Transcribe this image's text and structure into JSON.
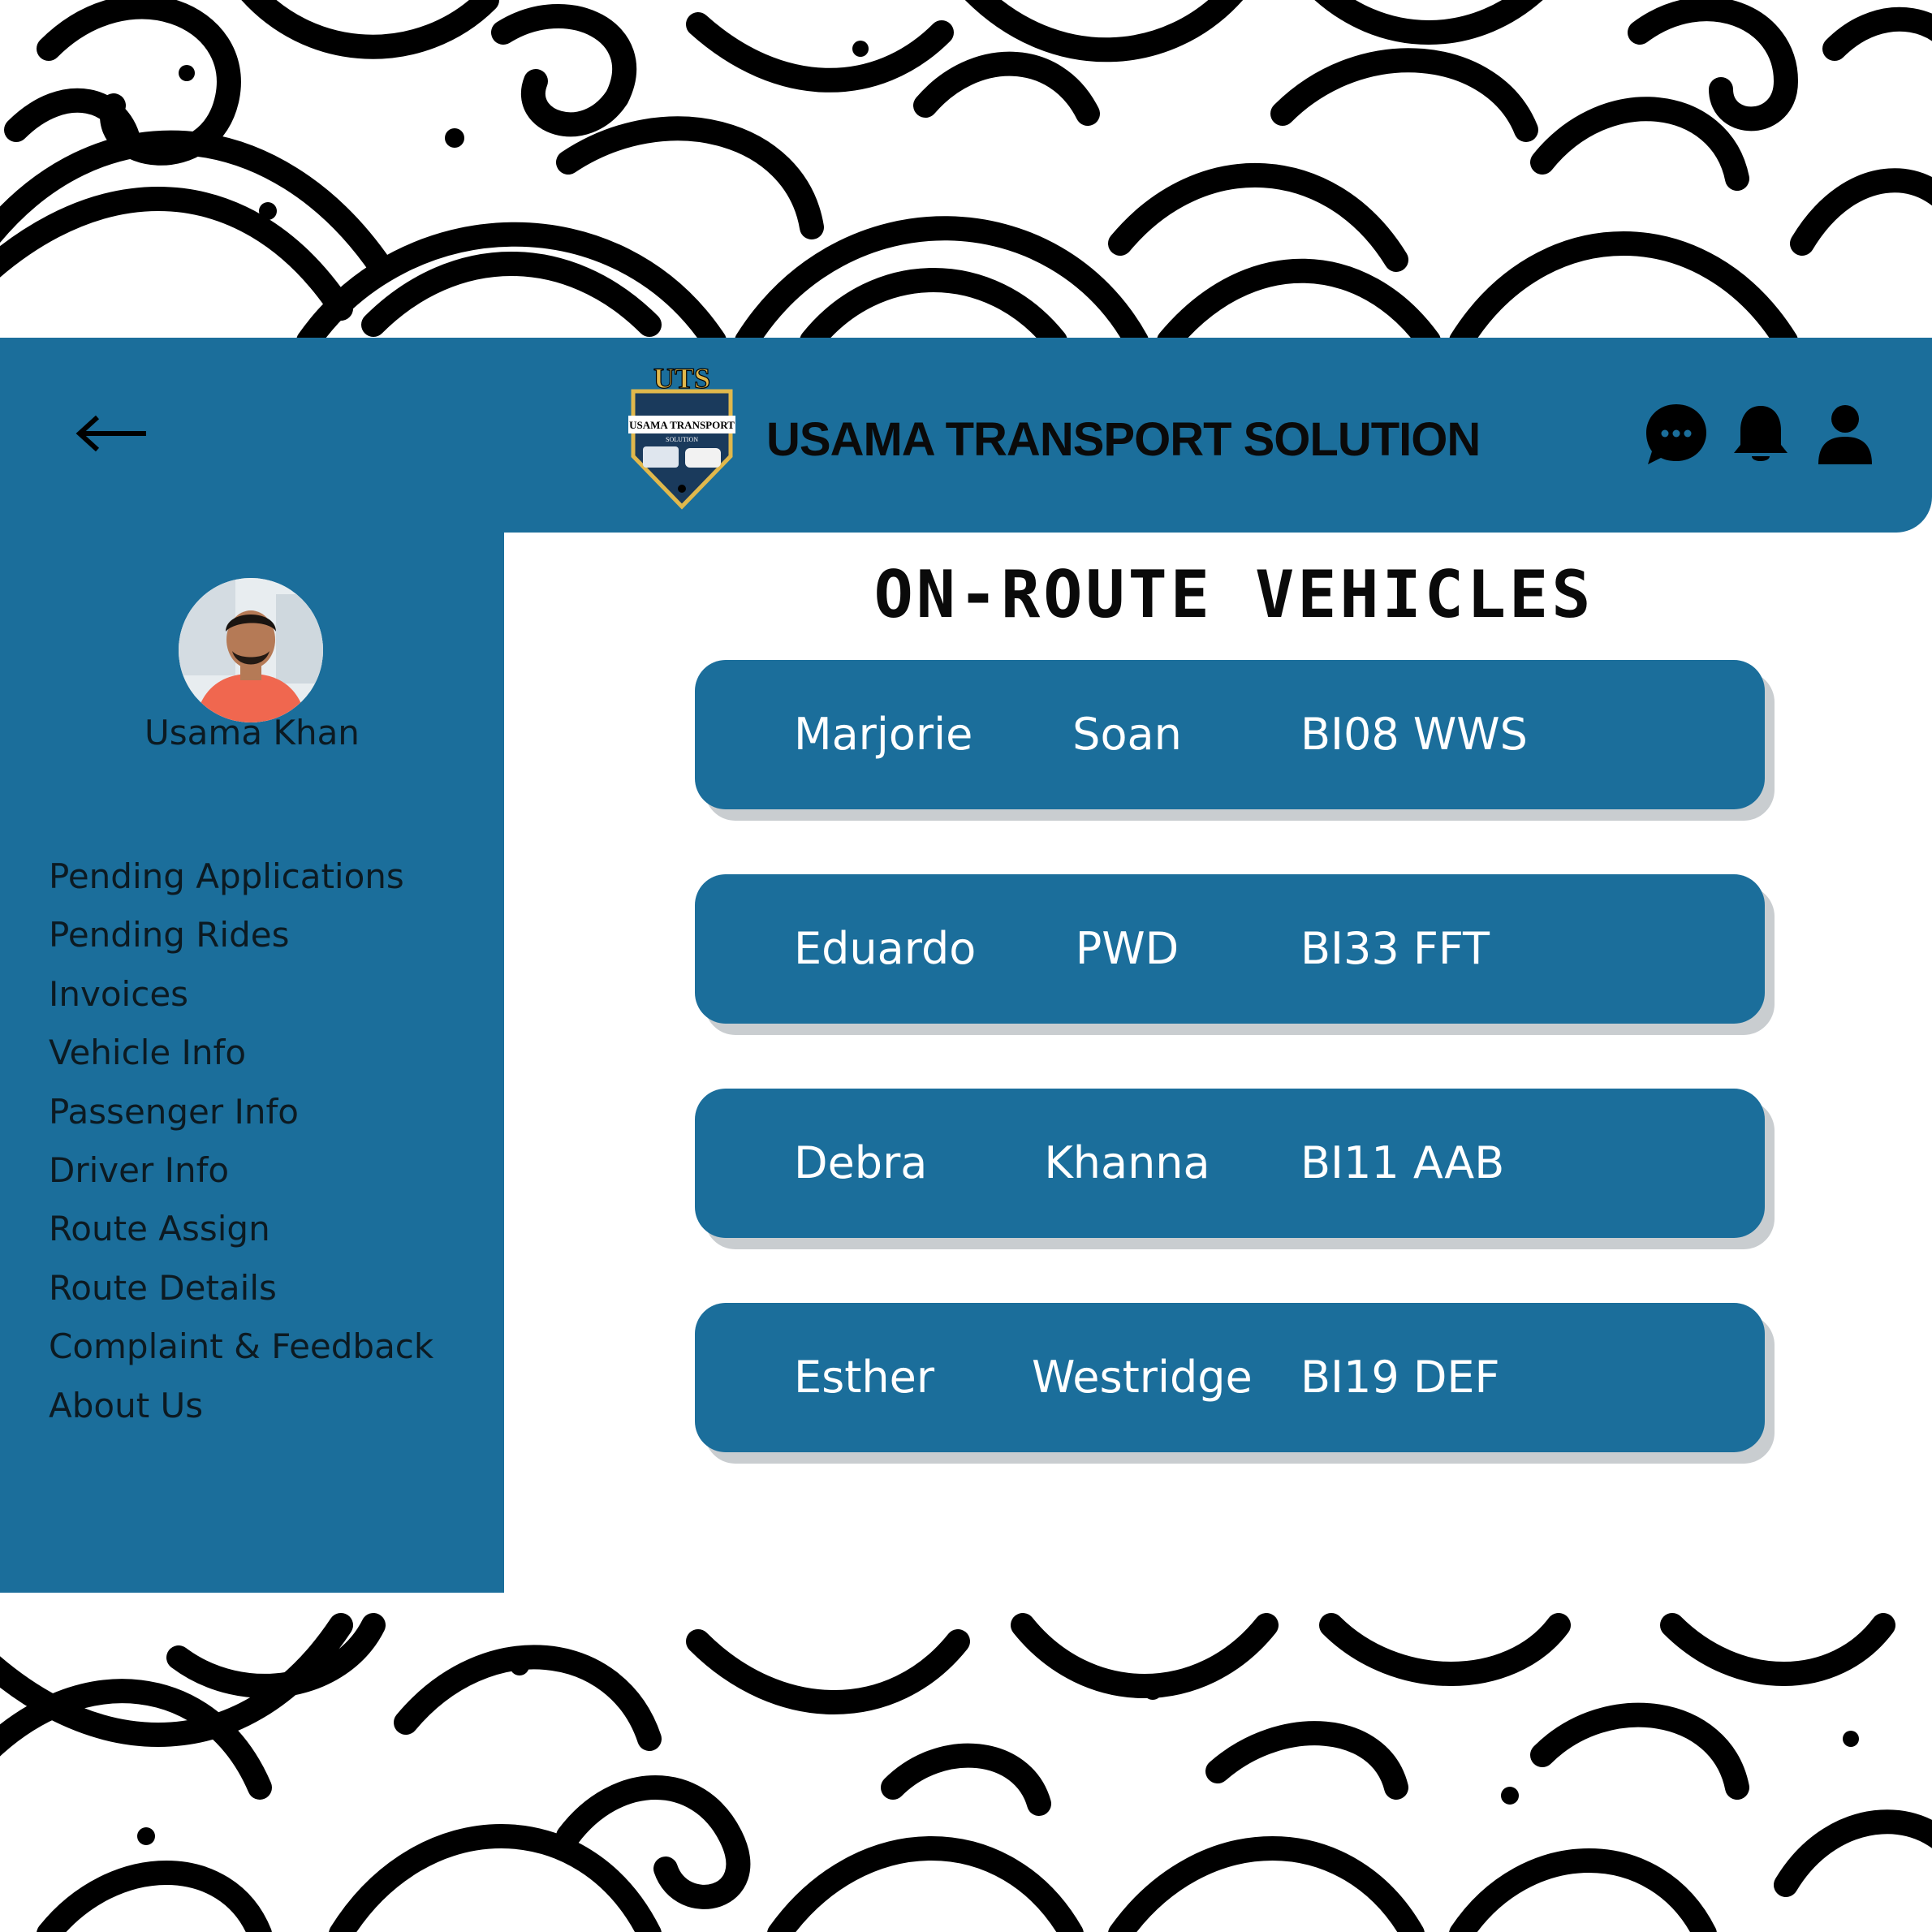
{
  "header": {
    "title": "USAMA TRANSPORT SOLUTION",
    "logo": {
      "monogram": "UTS",
      "text": "USAMA TRANSPORT",
      "subtext": "SOLUTION"
    },
    "back_icon": "arrow-left-icon",
    "icons": [
      "chat-icon",
      "bell-icon",
      "user-icon"
    ]
  },
  "sidebar": {
    "user_name": "Usama Khan",
    "items": [
      {
        "label": "Pending Applications"
      },
      {
        "label": "Pending Rides"
      },
      {
        "label": "Invoices"
      },
      {
        "label": "Vehicle Info"
      },
      {
        "label": "Passenger Info"
      },
      {
        "label": "Driver Info"
      },
      {
        "label": "Route Assign"
      },
      {
        "label": "Route Details"
      },
      {
        "label": "Complaint & Feedback"
      },
      {
        "label": "About Us"
      }
    ]
  },
  "main": {
    "title": "ON-ROUTE VEHICLES",
    "vehicles": [
      {
        "first_name": "Marjorie",
        "last_name": "Soan",
        "plate": "BI08 WWS"
      },
      {
        "first_name": "Eduardo",
        "last_name": "PWD",
        "plate": "BI33 FFT"
      },
      {
        "first_name": "Debra",
        "last_name": "Khanna",
        "plate": "BI11 AAB"
      },
      {
        "first_name": "Esther",
        "last_name": "Westridge",
        "plate": "BI19 DEF"
      }
    ]
  },
  "colors": {
    "primary": "#1b6e9b",
    "text_dark": "#0a0a0a",
    "card_shadow": "#c9cdd0",
    "background": "#ffffff"
  }
}
